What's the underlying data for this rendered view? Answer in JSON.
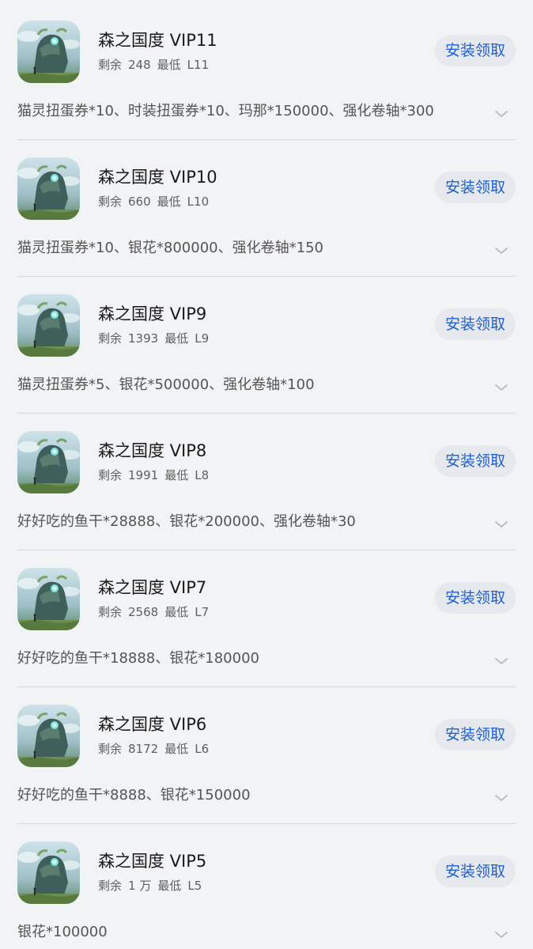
{
  "colors": {
    "background": "#f1f3f5",
    "button_bg": "#e5e8ec",
    "button_text": "#1f5fd6",
    "title_text": "#1a1a1a",
    "meta_text": "#5f5f5f",
    "desc_text": "#555555",
    "divider": "#d8d8d8"
  },
  "gifts": [
    {
      "title": "森之国度 VIP11",
      "remaining_label": "剩余",
      "remaining": "248",
      "min_label": "最低",
      "min_level": "L11",
      "button": "安装领取",
      "description": "猫灵扭蛋券*10、时装扭蛋券*10、玛那*150000、强化卷轴*300",
      "icon": "game-icon",
      "expand_icon": "chevron-down-icon"
    },
    {
      "title": "森之国度 VIP10",
      "remaining_label": "剩余",
      "remaining": "660",
      "min_label": "最低",
      "min_level": "L10",
      "button": "安装领取",
      "description": "猫灵扭蛋券*10、银花*800000、强化卷轴*150",
      "icon": "game-icon",
      "expand_icon": "chevron-down-icon"
    },
    {
      "title": "森之国度 VIP9",
      "remaining_label": "剩余",
      "remaining": "1393",
      "min_label": "最低",
      "min_level": "L9",
      "button": "安装领取",
      "description": "猫灵扭蛋券*5、银花*500000、强化卷轴*100",
      "icon": "game-icon",
      "expand_icon": "chevron-down-icon"
    },
    {
      "title": "森之国度 VIP8",
      "remaining_label": "剩余",
      "remaining": "1991",
      "min_label": "最低",
      "min_level": "L8",
      "button": "安装领取",
      "description": "好好吃的鱼干*28888、银花*200000、强化卷轴*30",
      "icon": "game-icon",
      "expand_icon": "chevron-down-icon"
    },
    {
      "title": "森之国度 VIP7",
      "remaining_label": "剩余",
      "remaining": "2568",
      "min_label": "最低",
      "min_level": "L7",
      "button": "安装领取",
      "description": "好好吃的鱼干*18888、银花*180000",
      "icon": "game-icon",
      "expand_icon": "chevron-down-icon"
    },
    {
      "title": "森之国度 VIP6",
      "remaining_label": "剩余",
      "remaining": "8172",
      "min_label": "最低",
      "min_level": "L6",
      "button": "安装领取",
      "description": "好好吃的鱼干*8888、银花*150000",
      "icon": "game-icon",
      "expand_icon": "chevron-down-icon"
    },
    {
      "title": "森之国度 VIP5",
      "remaining_label": "剩余",
      "remaining": "1 万",
      "min_label": "最低",
      "min_level": "L5",
      "button": "安装领取",
      "description": "银花*100000",
      "icon": "game-icon",
      "expand_icon": "chevron-down-icon"
    }
  ]
}
